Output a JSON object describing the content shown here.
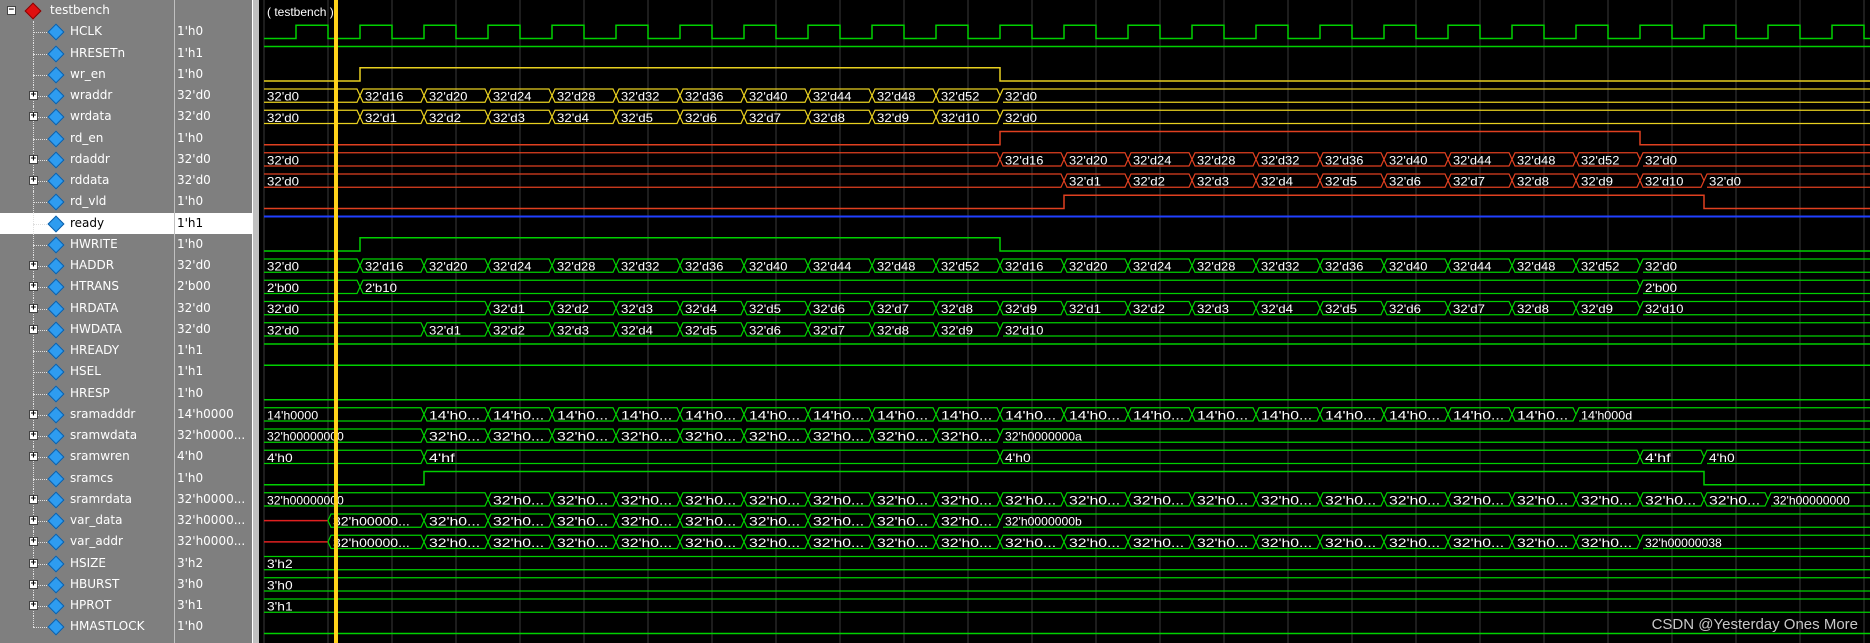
{
  "colors": {
    "clock": "#00d000",
    "control": "#00d000",
    "bus": "#e8d020",
    "read": "#e04020",
    "ready": "#2040ff",
    "cursor": "#ffd21a",
    "grid": "#3a3a3a"
  },
  "root": {
    "label": "testbench",
    "icon": "red-diamond-icon"
  },
  "time_label": "( testbench )",
  "signals": [
    {
      "name": "HCLK",
      "value": "1'h0",
      "expandable": false,
      "color": "clock",
      "kind": "clock"
    },
    {
      "name": "HRESETn",
      "value": "1'h1",
      "expandable": false,
      "color": "control",
      "kind": "const_high"
    },
    {
      "name": "wr_en",
      "value": "1'h0",
      "expandable": false,
      "color": "bus",
      "kind": "pulse",
      "start": 3,
      "end": 23
    },
    {
      "name": "wraddr",
      "value": "32'd0",
      "expandable": true,
      "color": "bus",
      "kind": "bus",
      "segments": [
        {
          "t": 0,
          "v": "32'd0"
        },
        {
          "t": 3,
          "v": "32'd16"
        },
        {
          "t": 5,
          "v": "32'd20"
        },
        {
          "t": 7,
          "v": "32'd24"
        },
        {
          "t": 9,
          "v": "32'd28"
        },
        {
          "t": 11,
          "v": "32'd32"
        },
        {
          "t": 13,
          "v": "32'd36"
        },
        {
          "t": 15,
          "v": "32'd40"
        },
        {
          "t": 17,
          "v": "32'd44"
        },
        {
          "t": 19,
          "v": "32'd48"
        },
        {
          "t": 21,
          "v": "32'd52"
        },
        {
          "t": 23,
          "v": "32'd0"
        }
      ]
    },
    {
      "name": "wrdata",
      "value": "32'd0",
      "expandable": true,
      "color": "bus",
      "kind": "bus",
      "segments": [
        {
          "t": 0,
          "v": "32'd0"
        },
        {
          "t": 3,
          "v": "32'd1"
        },
        {
          "t": 5,
          "v": "32'd2"
        },
        {
          "t": 7,
          "v": "32'd3"
        },
        {
          "t": 9,
          "v": "32'd4"
        },
        {
          "t": 11,
          "v": "32'd5"
        },
        {
          "t": 13,
          "v": "32'd6"
        },
        {
          "t": 15,
          "v": "32'd7"
        },
        {
          "t": 17,
          "v": "32'd8"
        },
        {
          "t": 19,
          "v": "32'd9"
        },
        {
          "t": 21,
          "v": "32'd10"
        },
        {
          "t": 23,
          "v": "32'd0"
        }
      ]
    },
    {
      "name": "rd_en",
      "value": "1'h0",
      "expandable": false,
      "color": "read",
      "kind": "pulse",
      "start": 23,
      "end": 43
    },
    {
      "name": "rdaddr",
      "value": "32'd0",
      "expandable": true,
      "color": "read",
      "kind": "bus",
      "segments": [
        {
          "t": 0,
          "v": "32'd0"
        },
        {
          "t": 23,
          "v": "32'd16"
        },
        {
          "t": 25,
          "v": "32'd20"
        },
        {
          "t": 27,
          "v": "32'd24"
        },
        {
          "t": 29,
          "v": "32'd28"
        },
        {
          "t": 31,
          "v": "32'd32"
        },
        {
          "t": 33,
          "v": "32'd36"
        },
        {
          "t": 35,
          "v": "32'd40"
        },
        {
          "t": 37,
          "v": "32'd44"
        },
        {
          "t": 39,
          "v": "32'd48"
        },
        {
          "t": 41,
          "v": "32'd52"
        },
        {
          "t": 43,
          "v": "32'd0"
        }
      ]
    },
    {
      "name": "rddata",
      "value": "32'd0",
      "expandable": true,
      "color": "read",
      "kind": "bus",
      "segments": [
        {
          "t": 0,
          "v": "32'd0"
        },
        {
          "t": 25,
          "v": "32'd1"
        },
        {
          "t": 27,
          "v": "32'd2"
        },
        {
          "t": 29,
          "v": "32'd3"
        },
        {
          "t": 31,
          "v": "32'd4"
        },
        {
          "t": 33,
          "v": "32'd5"
        },
        {
          "t": 35,
          "v": "32'd6"
        },
        {
          "t": 37,
          "v": "32'd7"
        },
        {
          "t": 39,
          "v": "32'd8"
        },
        {
          "t": 41,
          "v": "32'd9"
        },
        {
          "t": 43,
          "v": "32'd10"
        },
        {
          "t": 45,
          "v": "32'd0"
        }
      ]
    },
    {
      "name": "rd_vld",
      "value": "1'h0",
      "expandable": false,
      "color": "read",
      "kind": "pulse",
      "start": 25,
      "end": 45
    },
    {
      "name": "ready",
      "value": "1'h1",
      "expandable": false,
      "color": "ready",
      "kind": "const_high",
      "selected": true
    },
    {
      "name": "HWRITE",
      "value": "1'h0",
      "expandable": false,
      "color": "control",
      "kind": "pulse",
      "start": 3,
      "end": 23
    },
    {
      "name": "HADDR",
      "value": "32'd0",
      "expandable": true,
      "color": "control",
      "kind": "bus",
      "segments": [
        {
          "t": 0,
          "v": "32'd0"
        },
        {
          "t": 3,
          "v": "32'd16"
        },
        {
          "t": 5,
          "v": "32'd20"
        },
        {
          "t": 7,
          "v": "32'd24"
        },
        {
          "t": 9,
          "v": "32'd28"
        },
        {
          "t": 11,
          "v": "32'd32"
        },
        {
          "t": 13,
          "v": "32'd36"
        },
        {
          "t": 15,
          "v": "32'd40"
        },
        {
          "t": 17,
          "v": "32'd44"
        },
        {
          "t": 19,
          "v": "32'd48"
        },
        {
          "t": 21,
          "v": "32'd52"
        },
        {
          "t": 23,
          "v": "32'd16"
        },
        {
          "t": 25,
          "v": "32'd20"
        },
        {
          "t": 27,
          "v": "32'd24"
        },
        {
          "t": 29,
          "v": "32'd28"
        },
        {
          "t": 31,
          "v": "32'd32"
        },
        {
          "t": 33,
          "v": "32'd36"
        },
        {
          "t": 35,
          "v": "32'd40"
        },
        {
          "t": 37,
          "v": "32'd44"
        },
        {
          "t": 39,
          "v": "32'd48"
        },
        {
          "t": 41,
          "v": "32'd52"
        },
        {
          "t": 43,
          "v": "32'd0"
        }
      ]
    },
    {
      "name": "HTRANS",
      "value": "2'b00",
      "expandable": true,
      "color": "control",
      "kind": "bus",
      "segments": [
        {
          "t": 0,
          "v": "2'b00"
        },
        {
          "t": 3,
          "v": "2'b10"
        },
        {
          "t": 43,
          "v": "2'b00"
        }
      ]
    },
    {
      "name": "HRDATA",
      "value": "32'd0",
      "expandable": true,
      "color": "control",
      "kind": "bus",
      "segments": [
        {
          "t": 0,
          "v": "32'd0"
        },
        {
          "t": 7,
          "v": "32'd1"
        },
        {
          "t": 9,
          "v": "32'd2"
        },
        {
          "t": 11,
          "v": "32'd3"
        },
        {
          "t": 13,
          "v": "32'd4"
        },
        {
          "t": 15,
          "v": "32'd5"
        },
        {
          "t": 17,
          "v": "32'd6"
        },
        {
          "t": 19,
          "v": "32'd7"
        },
        {
          "t": 21,
          "v": "32'd8"
        },
        {
          "t": 23,
          "v": "32'd9"
        },
        {
          "t": 25,
          "v": "32'd1"
        },
        {
          "t": 27,
          "v": "32'd2"
        },
        {
          "t": 29,
          "v": "32'd3"
        },
        {
          "t": 31,
          "v": "32'd4"
        },
        {
          "t": 33,
          "v": "32'd5"
        },
        {
          "t": 35,
          "v": "32'd6"
        },
        {
          "t": 37,
          "v": "32'd7"
        },
        {
          "t": 39,
          "v": "32'd8"
        },
        {
          "t": 41,
          "v": "32'd9"
        },
        {
          "t": 43,
          "v": "32'd10"
        }
      ]
    },
    {
      "name": "HWDATA",
      "value": "32'd0",
      "expandable": true,
      "color": "control",
      "kind": "bus",
      "segments": [
        {
          "t": 0,
          "v": "32'd0"
        },
        {
          "t": 5,
          "v": "32'd1"
        },
        {
          "t": 7,
          "v": "32'd2"
        },
        {
          "t": 9,
          "v": "32'd3"
        },
        {
          "t": 11,
          "v": "32'd4"
        },
        {
          "t": 13,
          "v": "32'd5"
        },
        {
          "t": 15,
          "v": "32'd6"
        },
        {
          "t": 17,
          "v": "32'd7"
        },
        {
          "t": 19,
          "v": "32'd8"
        },
        {
          "t": 21,
          "v": "32'd9"
        },
        {
          "t": 23,
          "v": "32'd10"
        }
      ]
    },
    {
      "name": "HREADY",
      "value": "1'h1",
      "expandable": false,
      "color": "control",
      "kind": "const_high"
    },
    {
      "name": "HSEL",
      "value": "1'h1",
      "expandable": false,
      "color": "control",
      "kind": "const_high"
    },
    {
      "name": "HRESP",
      "value": "1'h0",
      "expandable": false,
      "color": "control",
      "kind": "const_low"
    },
    {
      "name": "sramadddr",
      "value": "14'h0000",
      "expandable": true,
      "color": "control",
      "kind": "bus",
      "segments": [
        {
          "t": 0,
          "v": "14'h0000"
        },
        {
          "t": 5,
          "v": "14'h0..."
        },
        {
          "t": 7,
          "v": "14'h0..."
        },
        {
          "t": 9,
          "v": "14'h0..."
        },
        {
          "t": 11,
          "v": "14'h0..."
        },
        {
          "t": 13,
          "v": "14'h0..."
        },
        {
          "t": 15,
          "v": "14'h0..."
        },
        {
          "t": 17,
          "v": "14'h0..."
        },
        {
          "t": 19,
          "v": "14'h0..."
        },
        {
          "t": 21,
          "v": "14'h0..."
        },
        {
          "t": 23,
          "v": "14'h0..."
        },
        {
          "t": 25,
          "v": "14'h0..."
        },
        {
          "t": 27,
          "v": "14'h0..."
        },
        {
          "t": 29,
          "v": "14'h0..."
        },
        {
          "t": 31,
          "v": "14'h0..."
        },
        {
          "t": 33,
          "v": "14'h0..."
        },
        {
          "t": 35,
          "v": "14'h0..."
        },
        {
          "t": 37,
          "v": "14'h0..."
        },
        {
          "t": 39,
          "v": "14'h0..."
        },
        {
          "t": 41,
          "v": "14'h000d"
        }
      ]
    },
    {
      "name": "sramwdata",
      "value": "32'h0000...",
      "expandable": true,
      "color": "control",
      "kind": "bus",
      "segments": [
        {
          "t": 0,
          "v": "32'h00000000"
        },
        {
          "t": 5,
          "v": "32'h0..."
        },
        {
          "t": 7,
          "v": "32'h0..."
        },
        {
          "t": 9,
          "v": "32'h0..."
        },
        {
          "t": 11,
          "v": "32'h0..."
        },
        {
          "t": 13,
          "v": "32'h0..."
        },
        {
          "t": 15,
          "v": "32'h0..."
        },
        {
          "t": 17,
          "v": "32'h0..."
        },
        {
          "t": 19,
          "v": "32'h0..."
        },
        {
          "t": 21,
          "v": "32'h0..."
        },
        {
          "t": 23,
          "v": "32'h0000000a"
        }
      ]
    },
    {
      "name": "sramwren",
      "value": "4'h0",
      "expandable": true,
      "color": "control",
      "kind": "bus",
      "segments": [
        {
          "t": 0,
          "v": "4'h0"
        },
        {
          "t": 5,
          "v": "4'hf"
        },
        {
          "t": 23,
          "v": "4'h0"
        },
        {
          "t": 43,
          "v": "4'hf"
        },
        {
          "t": 45,
          "v": "4'h0"
        }
      ]
    },
    {
      "name": "sramcs",
      "value": "1'h0",
      "expandable": false,
      "color": "control",
      "kind": "pulse",
      "start": 5,
      "end": 45
    },
    {
      "name": "sramrdata",
      "value": "32'h0000...",
      "expandable": true,
      "color": "control",
      "kind": "bus",
      "segments": [
        {
          "t": 0,
          "v": "32'h00000000"
        },
        {
          "t": 7,
          "v": "32'h0..."
        },
        {
          "t": 9,
          "v": "32'h0..."
        },
        {
          "t": 11,
          "v": "32'h0..."
        },
        {
          "t": 13,
          "v": "32'h0..."
        },
        {
          "t": 15,
          "v": "32'h0..."
        },
        {
          "t": 17,
          "v": "32'h0..."
        },
        {
          "t": 19,
          "v": "32'h0..."
        },
        {
          "t": 21,
          "v": "32'h0..."
        },
        {
          "t": 23,
          "v": "32'h0..."
        },
        {
          "t": 25,
          "v": "32'h0..."
        },
        {
          "t": 27,
          "v": "32'h0..."
        },
        {
          "t": 29,
          "v": "32'h0..."
        },
        {
          "t": 31,
          "v": "32'h0..."
        },
        {
          "t": 33,
          "v": "32'h0..."
        },
        {
          "t": 35,
          "v": "32'h0..."
        },
        {
          "t": 37,
          "v": "32'h0..."
        },
        {
          "t": 39,
          "v": "32'h0..."
        },
        {
          "t": 41,
          "v": "32'h0..."
        },
        {
          "t": 43,
          "v": "32'h0..."
        },
        {
          "t": 45,
          "v": "32'h0..."
        },
        {
          "t": 47,
          "v": "32'h00000000"
        }
      ]
    },
    {
      "name": "var_data",
      "value": "32'h0000...",
      "expandable": true,
      "color": "control",
      "kind": "bus",
      "redStart": true,
      "segments": [
        {
          "t": 2,
          "v": "32'h00000..."
        },
        {
          "t": 5,
          "v": "32'h0..."
        },
        {
          "t": 7,
          "v": "32'h0..."
        },
        {
          "t": 9,
          "v": "32'h0..."
        },
        {
          "t": 11,
          "v": "32'h0..."
        },
        {
          "t": 13,
          "v": "32'h0..."
        },
        {
          "t": 15,
          "v": "32'h0..."
        },
        {
          "t": 17,
          "v": "32'h0..."
        },
        {
          "t": 19,
          "v": "32'h0..."
        },
        {
          "t": 21,
          "v": "32'h0..."
        },
        {
          "t": 23,
          "v": "32'h0000000b"
        }
      ]
    },
    {
      "name": "var_addr",
      "value": "32'h0000...",
      "expandable": true,
      "color": "control",
      "kind": "bus",
      "redStart": true,
      "segments": [
        {
          "t": 2,
          "v": "32'h00000..."
        },
        {
          "t": 5,
          "v": "32'h0..."
        },
        {
          "t": 7,
          "v": "32'h0..."
        },
        {
          "t": 9,
          "v": "32'h0..."
        },
        {
          "t": 11,
          "v": "32'h0..."
        },
        {
          "t": 13,
          "v": "32'h0..."
        },
        {
          "t": 15,
          "v": "32'h0..."
        },
        {
          "t": 17,
          "v": "32'h0..."
        },
        {
          "t": 19,
          "v": "32'h0..."
        },
        {
          "t": 21,
          "v": "32'h0..."
        },
        {
          "t": 23,
          "v": "32'h0..."
        },
        {
          "t": 25,
          "v": "32'h0..."
        },
        {
          "t": 27,
          "v": "32'h0..."
        },
        {
          "t": 29,
          "v": "32'h0..."
        },
        {
          "t": 31,
          "v": "32'h0..."
        },
        {
          "t": 33,
          "v": "32'h0..."
        },
        {
          "t": 35,
          "v": "32'h0..."
        },
        {
          "t": 37,
          "v": "32'h0..."
        },
        {
          "t": 39,
          "v": "32'h0..."
        },
        {
          "t": 41,
          "v": "32'h0..."
        },
        {
          "t": 43,
          "v": "32'h00000038"
        }
      ]
    },
    {
      "name": "HSIZE",
      "value": "3'h2",
      "expandable": true,
      "color": "control",
      "kind": "bus",
      "segments": [
        {
          "t": 0,
          "v": "3'h2"
        }
      ]
    },
    {
      "name": "HBURST",
      "value": "3'h0",
      "expandable": true,
      "color": "control",
      "kind": "bus",
      "segments": [
        {
          "t": 0,
          "v": "3'h0"
        }
      ]
    },
    {
      "name": "HPROT",
      "value": "3'h1",
      "expandable": true,
      "color": "control",
      "kind": "bus",
      "segments": [
        {
          "t": 0,
          "v": "3'h1"
        }
      ]
    },
    {
      "name": "HMASTLOCK",
      "value": "1'h0",
      "expandable": false,
      "color": "control",
      "kind": "const_low"
    }
  ],
  "watermark": "CSDN @Yesterday Ones More"
}
